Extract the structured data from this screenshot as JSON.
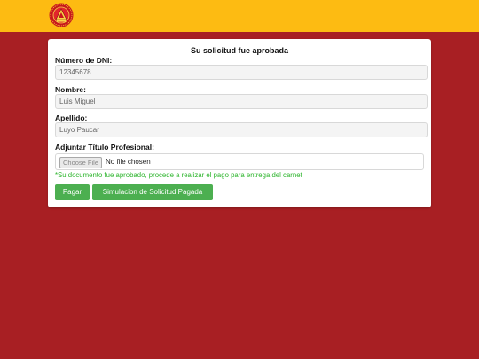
{
  "form": {
    "title": "Su solicitud fue aprobada",
    "dni_label": "Número de DNI:",
    "dni_value": "12345678",
    "nombre_label": "Nombre:",
    "nombre_value": "Luis Miguel",
    "apellido_label": "Apellido:",
    "apellido_value": "Luyo Paucar",
    "adjuntar_label": "Adjuntar Título Profesional:",
    "choose_file": "Choose File",
    "no_file": "No file chosen",
    "note": "*Su documento fue aprobado, procede a realizar el pago para entrega del carnet"
  },
  "buttons": {
    "pagar": "Pagar",
    "simulacion": "Simulacion de Solicitud Pagada"
  },
  "colors": {
    "header": "#fdbb12",
    "background": "#a81f23",
    "button": "#4caf50",
    "note": "#2db52d"
  },
  "icons": {
    "logo": "institution-seal-icon"
  }
}
